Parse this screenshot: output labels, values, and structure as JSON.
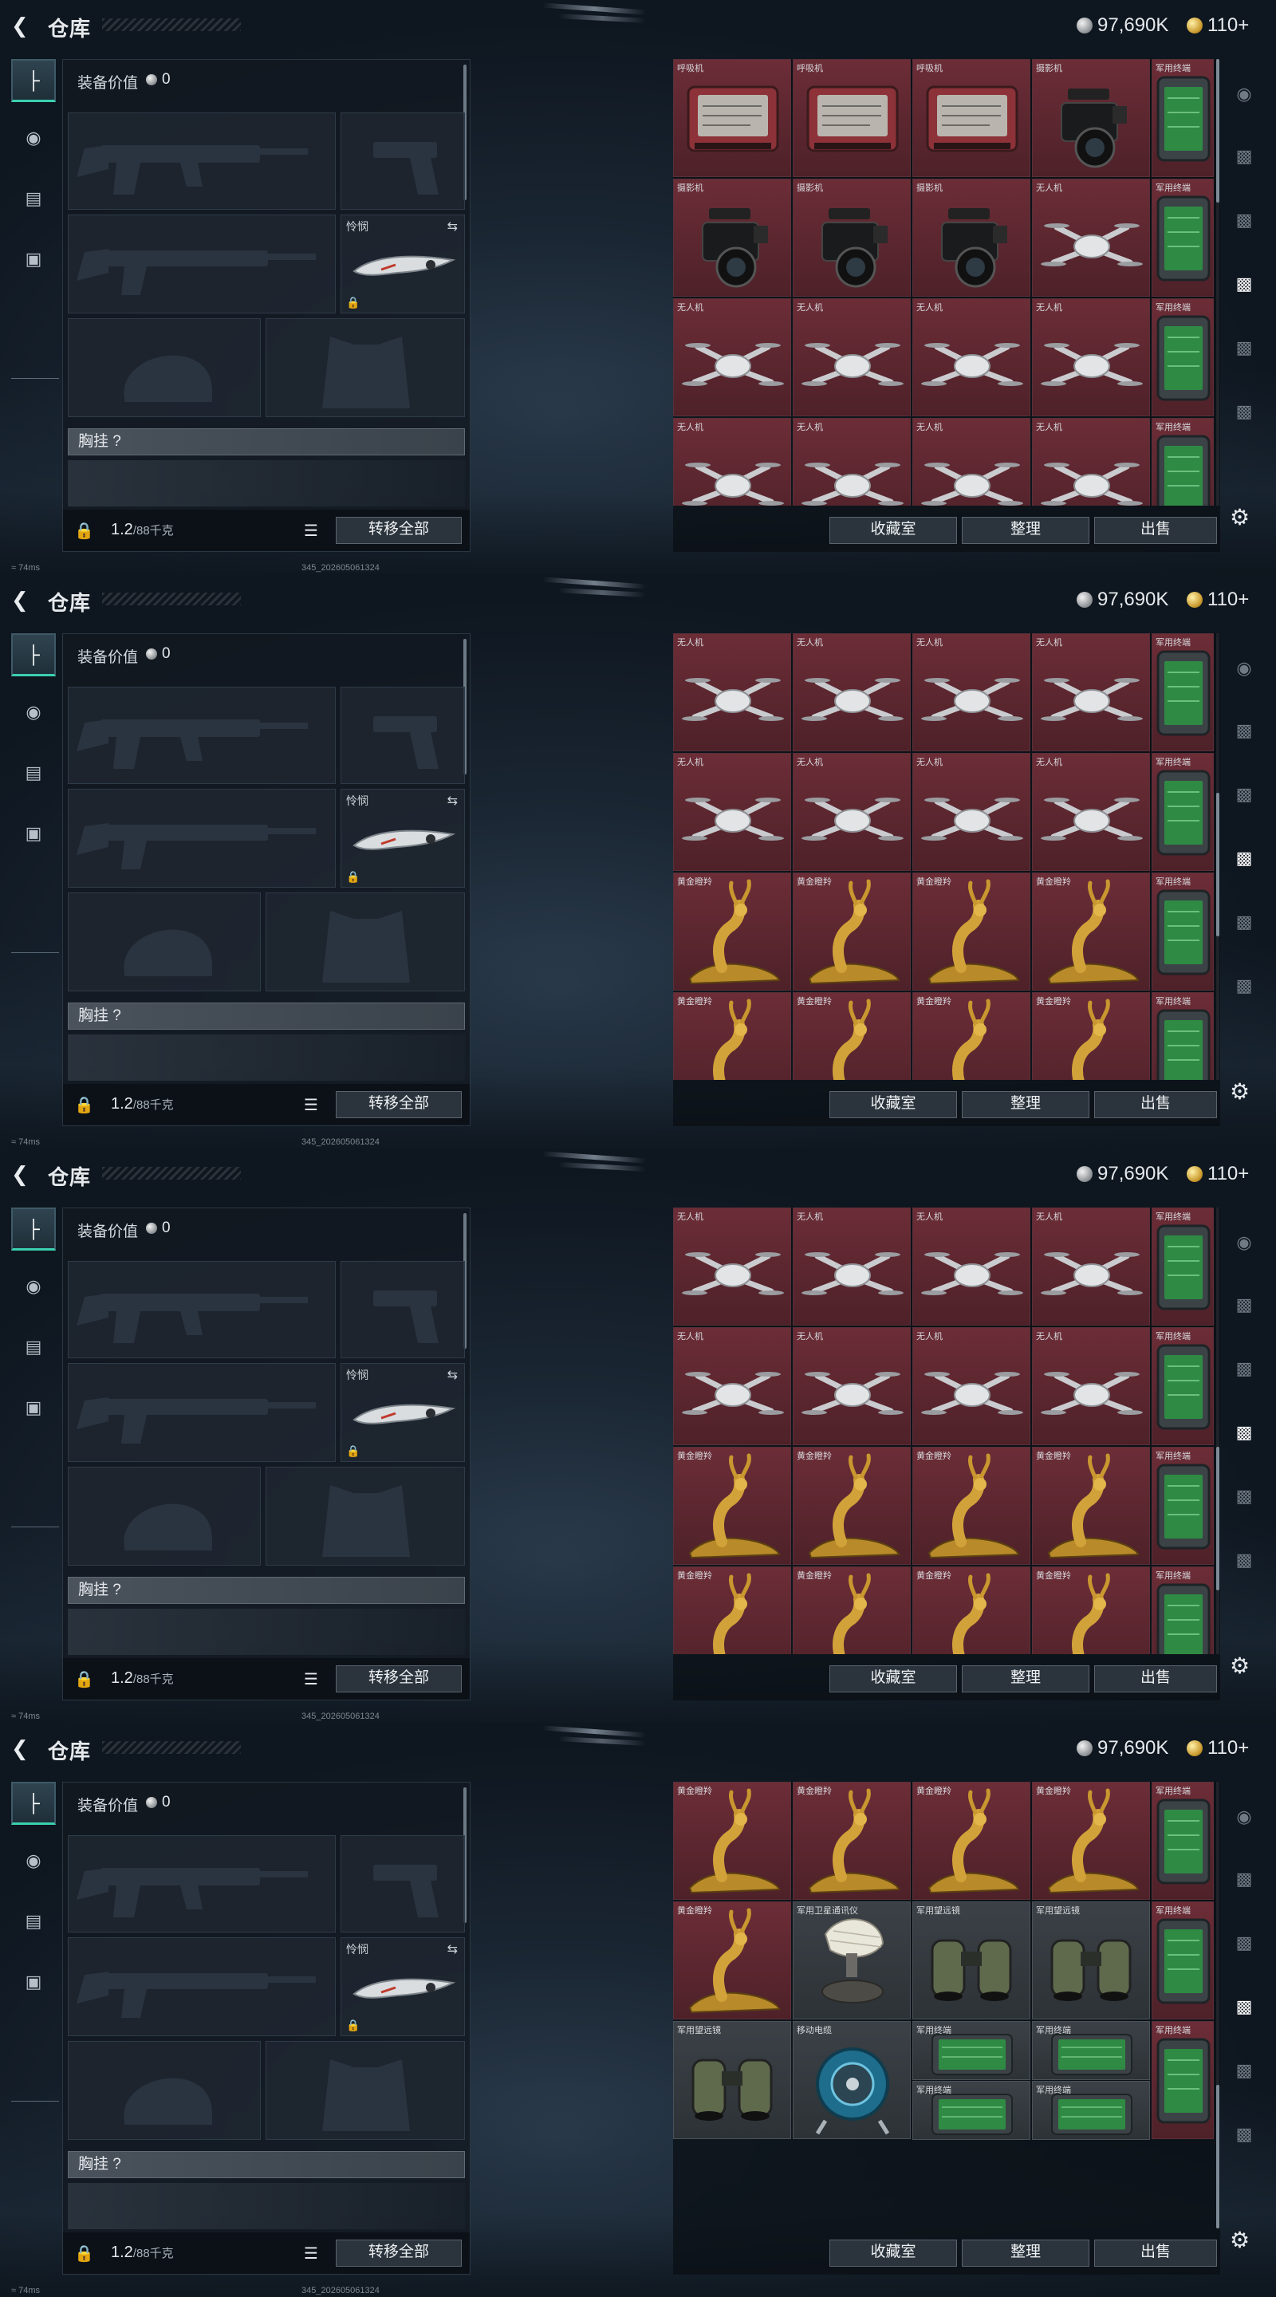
{
  "topbar": {
    "back_icon": "arrow-left-icon",
    "title": "仓库",
    "silver": "97,690K",
    "gold": "110+"
  },
  "equipment": {
    "value_label": "装备价值",
    "value": "0",
    "melee_label": "怜悯",
    "chest_label": "胸挂 ?",
    "weight": "1.2",
    "weight_max": "/88千克",
    "transfer_all": "转移全部"
  },
  "actions": {
    "collection": "收藏室",
    "sort": "整理",
    "sell": "出售"
  },
  "footer": {
    "ping": "74ms",
    "build": "345_202605061324"
  },
  "item_types": {
    "R": {
      "name": "呼吸机",
      "icon": "ventilator-icon"
    },
    "C": {
      "name": "摄影机",
      "icon": "camera-icon"
    },
    "D": {
      "name": "无人机",
      "icon": "drone-icon"
    },
    "G": {
      "name": "黄金瞪羚",
      "icon": "golden-gazelle-icon"
    },
    "T": {
      "name": "军用终端",
      "icon": "military-terminal-icon"
    },
    "S": {
      "name": "军用卫星通讯仪",
      "icon": "satellite-communicator-icon"
    },
    "B": {
      "name": "军用望远镜",
      "icon": "binoculars-icon"
    },
    "P": {
      "name": "移动电缆",
      "icon": "cable-reel-icon"
    },
    "H": {
      "name": "军用终端",
      "icon": "military-terminal-icon"
    }
  },
  "screens": [
    {
      "rows": [
        [
          "R",
          "R",
          "R",
          "C",
          "T"
        ],
        [
          "C",
          "C",
          "C",
          "D",
          "T"
        ],
        [
          "D",
          "D",
          "D",
          "D",
          "T"
        ],
        [
          "D",
          "D",
          "D",
          "D",
          "T"
        ]
      ]
    },
    {
      "rows": [
        [
          "D",
          "D",
          "D",
          "D",
          "T"
        ],
        [
          "D",
          "D",
          "D",
          "D",
          "T"
        ],
        [
          "G",
          "G",
          "G",
          "G",
          "T"
        ],
        [
          "G",
          "G",
          "G",
          "G",
          "T"
        ]
      ]
    },
    {
      "rows": [
        [
          "D",
          "D",
          "D",
          "D",
          "T"
        ],
        [
          "D",
          "D",
          "D",
          "D",
          "T"
        ],
        [
          "G",
          "G",
          "G",
          "G",
          "T"
        ],
        [
          "G",
          "G",
          "G",
          "G",
          "T"
        ]
      ]
    },
    {
      "rows": [
        [
          "G",
          "G",
          "G",
          "G",
          "T"
        ],
        [
          "G",
          "S",
          "B",
          "B",
          "T"
        ],
        [
          "B",
          "P",
          "H",
          "H",
          "T"
        ]
      ]
    }
  ],
  "colors": {
    "item_bg": "#5b2730",
    "accent": "#3ad0b0"
  }
}
